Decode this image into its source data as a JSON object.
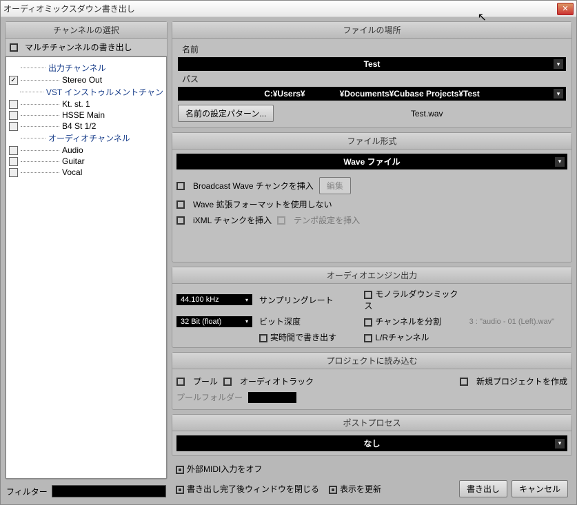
{
  "window": {
    "title": "オーディオミックスダウン書き出し"
  },
  "left": {
    "header": "チャンネルの選択",
    "multichannel": "マルチチャンネルの書き出し",
    "tree": {
      "output_channel": "出力チャンネル",
      "stereo_out": "Stereo Out",
      "vst_instrument": "VST インストゥルメントチャン",
      "kt": "Kt. st. 1",
      "hsse": "HSSE Main",
      "b4": "B4 St 1/2",
      "audio_channel": "オーディオチャンネル",
      "audio": "Audio",
      "guitar": "Guitar",
      "vocal": "Vocal"
    },
    "filter_label": "フィルター"
  },
  "file_loc": {
    "header": "ファイルの場所",
    "name_label": "名前",
    "name_value": "Test",
    "path_label": "パス",
    "path_prefix": "C:¥Users¥",
    "path_suffix": "¥Documents¥Cubase Projects¥Test",
    "pattern_btn": "名前の設定パターン...",
    "filename": "Test.wav"
  },
  "file_fmt": {
    "header": "ファイル形式",
    "format": "Wave ファイル",
    "broadcast": "Broadcast Wave チャンクを挿入",
    "edit_btn": "編集",
    "noext": "Wave 拡張フォーマットを使用しない",
    "ixml": "iXML チャンクを挿入",
    "tempo": "テンポ設定を挿入"
  },
  "engine": {
    "header": "オーディオエンジン出力",
    "sr_val": "44.100 kHz",
    "sr_label": "サンプリングレート",
    "mono": "モノラルダウンミックス",
    "bd_val": "32 Bit (float)",
    "bd_label": "ビット深度",
    "split": "チャンネルを分割",
    "split_file": "3 : \"audio - 01 (Left).wav\"",
    "realtime": "実時間で書き出す",
    "lr": "L/Rチャンネル"
  },
  "project": {
    "header": "プロジェクトに読み込む",
    "pool": "プール",
    "track": "オーディオトラック",
    "newproj": "新規プロジェクトを作成",
    "pool_folder": "プールフォルダー"
  },
  "post": {
    "header": "ポストプロセス",
    "value": "なし"
  },
  "bottom": {
    "midi_off": "外部MIDI入力をオフ",
    "close_after": "書き出し完了後ウィンドウを閉じる",
    "refresh": "表示を更新",
    "export": "書き出し",
    "cancel": "キャンセル"
  }
}
